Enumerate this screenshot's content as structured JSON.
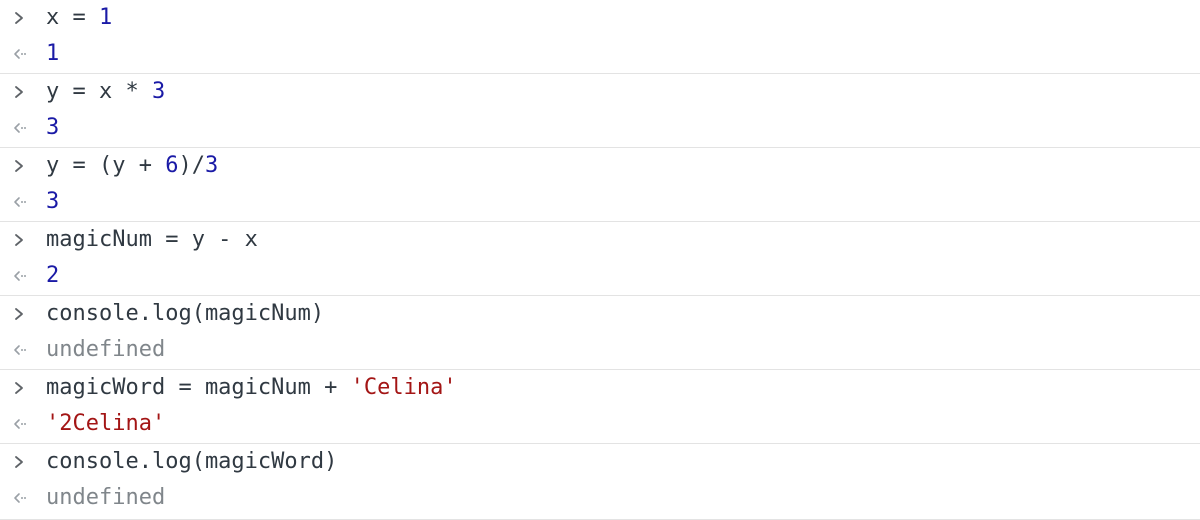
{
  "console": {
    "entries": [
      {
        "input": [
          {
            "t": "x = ",
            "k": "id"
          },
          {
            "t": "1",
            "k": "num"
          }
        ],
        "result": {
          "text": "1",
          "kind": "num"
        }
      },
      {
        "input": [
          {
            "t": "y = x * ",
            "k": "id"
          },
          {
            "t": "3",
            "k": "num"
          }
        ],
        "result": {
          "text": "3",
          "kind": "num"
        }
      },
      {
        "input": [
          {
            "t": "y = (y + ",
            "k": "id"
          },
          {
            "t": "6",
            "k": "num"
          },
          {
            "t": ")/",
            "k": "id"
          },
          {
            "t": "3",
            "k": "num"
          }
        ],
        "result": {
          "text": "3",
          "kind": "num"
        }
      },
      {
        "input": [
          {
            "t": "magicNum = y - x",
            "k": "id"
          }
        ],
        "result": {
          "text": "2",
          "kind": "num"
        }
      },
      {
        "input": [
          {
            "t": "console.log(magicNum)",
            "k": "id"
          }
        ],
        "result": {
          "text": "undefined",
          "kind": "undef"
        }
      },
      {
        "input": [
          {
            "t": "magicWord = magicNum + ",
            "k": "id"
          },
          {
            "t": "'Celina'",
            "k": "str"
          }
        ],
        "result": {
          "text": "'2Celina'",
          "kind": "str"
        }
      },
      {
        "input": [
          {
            "t": "console.log(magicWord)",
            "k": "id"
          }
        ],
        "result": {
          "text": "undefined",
          "kind": "undef"
        }
      }
    ]
  },
  "icons": {
    "prompt": "chevron-right-icon",
    "result": "return-arrow-icon"
  },
  "colors": {
    "number": "#1a1aa6",
    "string": "#a31515",
    "undefined": "#80868b",
    "text": "#303942",
    "divider": "#e3e3e3"
  }
}
